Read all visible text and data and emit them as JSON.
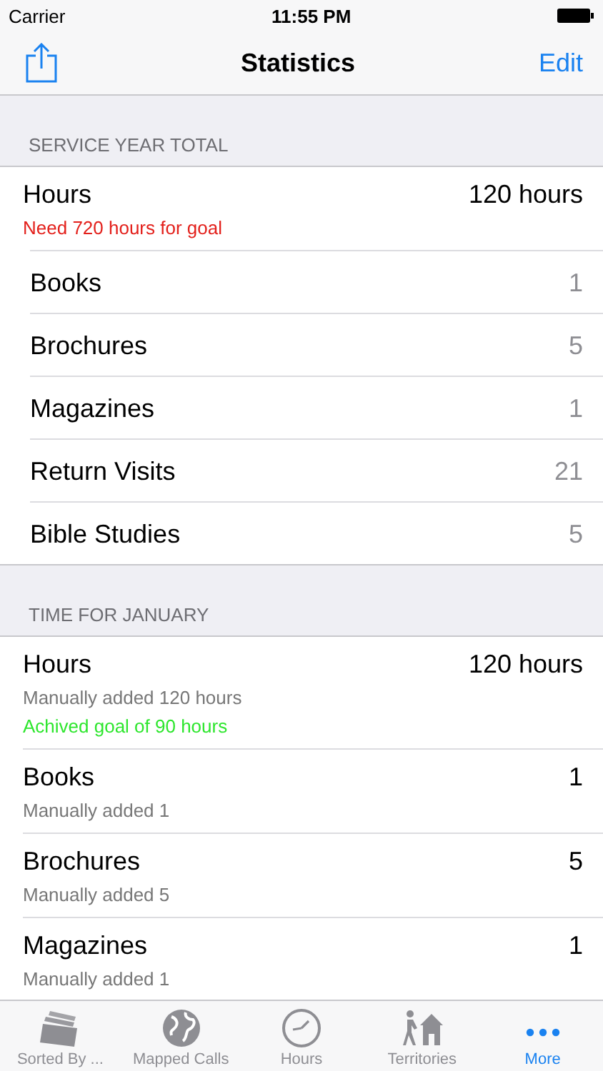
{
  "status_bar": {
    "carrier": "Carrier",
    "time": "11:55 PM"
  },
  "nav": {
    "title": "Statistics",
    "right_button": "Edit"
  },
  "sections": [
    {
      "header": "SERVICE YEAR TOTAL",
      "kind": "summary",
      "rows": [
        {
          "label": "Hours",
          "value": "120 hours",
          "notes": [
            {
              "text": "Need 720 hours for goal",
              "kind": "warning"
            }
          ]
        },
        {
          "label": "Books",
          "value": "1"
        },
        {
          "label": "Brochures",
          "value": "5"
        },
        {
          "label": "Magazines",
          "value": "1"
        },
        {
          "label": "Return Visits",
          "value": "21"
        },
        {
          "label": "Bible Studies",
          "value": "5"
        }
      ]
    },
    {
      "header": "TIME FOR JANUARY",
      "kind": "detail",
      "rows": [
        {
          "label": "Hours",
          "value": "120 hours",
          "notes": [
            {
              "text": "Manually added 120 hours",
              "kind": "info"
            },
            {
              "text": "Achived goal of 90 hours",
              "kind": "success"
            }
          ]
        },
        {
          "label": "Books",
          "value": "1",
          "notes": [
            {
              "text": "Manually added 1",
              "kind": "info"
            }
          ]
        },
        {
          "label": "Brochures",
          "value": "5",
          "notes": [
            {
              "text": "Manually added 5",
              "kind": "info"
            }
          ]
        },
        {
          "label": "Magazines",
          "value": "1",
          "notes": [
            {
              "text": "Manually added 1",
              "kind": "info"
            }
          ]
        }
      ]
    }
  ],
  "tabs": [
    {
      "label": "Sorted By ...",
      "kind": "cards",
      "selected": false
    },
    {
      "label": "Mapped Calls",
      "kind": "globe",
      "selected": false
    },
    {
      "label": "Hours",
      "kind": "clock",
      "selected": false
    },
    {
      "label": "Territories",
      "kind": "house",
      "selected": false
    },
    {
      "label": "More",
      "kind": "more",
      "selected": true
    }
  ]
}
